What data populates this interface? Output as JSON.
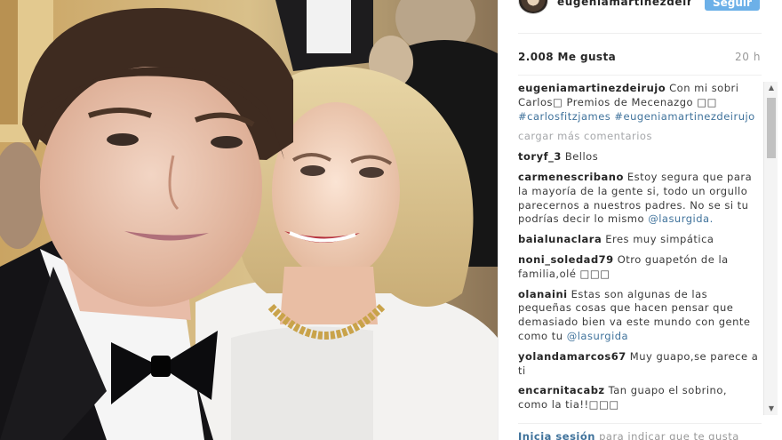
{
  "post": {
    "username": "eugeniamartinezdeiru…",
    "follow_label": "Seguir",
    "likes": "2.008 Me gusta",
    "time": "20 h"
  },
  "caption": {
    "user": "eugeniamartinezdeirujo",
    "text": "Con mi sobri Carlos□ Premios de Mecenazgo □□",
    "tags": "#carlosfitzjames #eugeniamartinezdeirujo"
  },
  "load_more": "cargar más comentarios",
  "comments": [
    {
      "user": "toryf_3",
      "text": "Bellos",
      "mention": ""
    },
    {
      "user": "carmenescribano",
      "text": "Estoy segura que para la mayoría de la gente si, todo un orgullo parecernos a nuestros padres. No se si tu podrías decir lo mismo",
      "mention": "@lasurgida."
    },
    {
      "user": "baialunaclara",
      "text": "Eres muy simpática",
      "mention": ""
    },
    {
      "user": "noni_soledad79",
      "text": "Otro guapetón de la familia,olé □□□",
      "mention": ""
    },
    {
      "user": "olanaini",
      "text": "Estas son algunas de las pequeñas cosas que hacen pensar que demasiado bien va este mundo con gente como tu",
      "mention": "@lasurgida"
    },
    {
      "user": "yolandamarcos67",
      "text": "Muy guapo,se parece a ti",
      "mention": ""
    },
    {
      "user": "encarnitacabz",
      "text": "Tan guapo el sobrino, como la tia!!□□□",
      "mention": ""
    }
  ],
  "footer": {
    "login": "Inicia sesión",
    "text": "para indicar que te gusta"
  },
  "colors": {
    "link": "#3f729b",
    "follow_button": "#6cb0e8",
    "muted": "#999999"
  },
  "icons": {
    "scroll_up": "scroll-up-arrow-icon",
    "scroll_down": "scroll-down-arrow-icon"
  }
}
